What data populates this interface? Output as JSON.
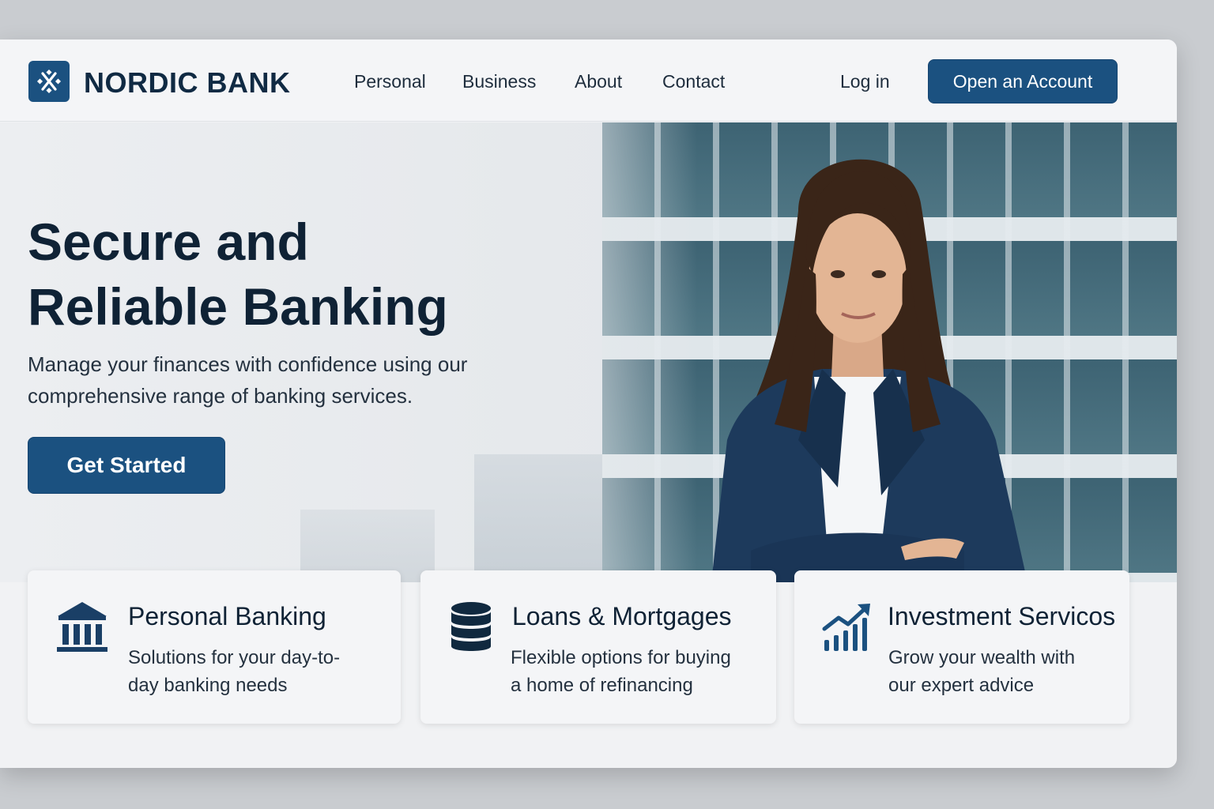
{
  "header": {
    "brand": "NORDIC BANK",
    "nav": [
      "Personal",
      "Business",
      "About",
      "Contact"
    ],
    "login_label": "Log in",
    "cta_label": "Open an Account"
  },
  "hero": {
    "title_line1": "Secure and",
    "title_line2": "Reliable Banking",
    "subtitle_line1": "Manage your finances with confidence using our",
    "subtitle_line2": "comprehensive range of banking services.",
    "button_label": "Get Started"
  },
  "cards": [
    {
      "icon": "bank-building-icon",
      "title": "Personal Banking",
      "desc_line1": "Solutions for your day-to-",
      "desc_line2": "day banking needs"
    },
    {
      "icon": "coin-stack-icon",
      "title": "Loans & Mortgages",
      "desc_line1": "Flexible options for buying",
      "desc_line2": "a home of refinancing"
    },
    {
      "icon": "growth-chart-icon",
      "title": "Investment Servicos",
      "desc_line1": "Grow your wealth with",
      "desc_line2": "our expert advice"
    }
  ],
  "colors": {
    "brand": "#1b5180",
    "text_dark": "#0f2235",
    "background": "#f1f2f4"
  }
}
